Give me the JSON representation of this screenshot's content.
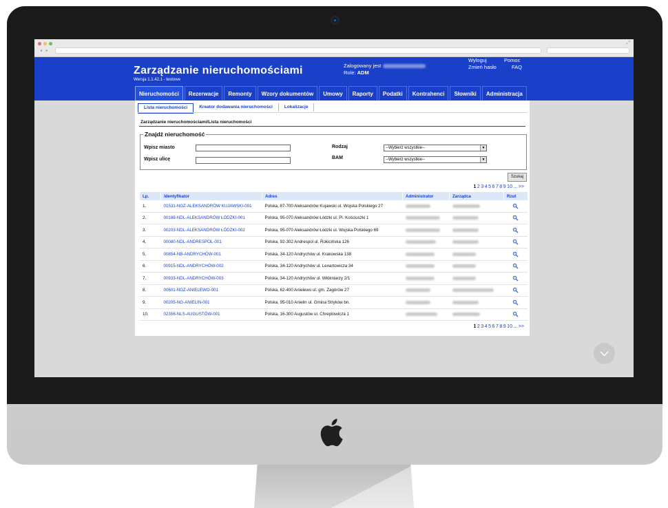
{
  "app": {
    "title": "Zarządzanie nieruchomościami",
    "version": "Wersja 1.1.42.1 - testowe",
    "logged_in_label": "Zalogowany jest",
    "role_label": "Role:",
    "role_value": "ADM",
    "links": {
      "logout": "Wyloguj",
      "change_password": "Zmień hasło",
      "help": "Pomoc",
      "faq": "FAQ"
    }
  },
  "menu": [
    {
      "label": "Nieruchomości",
      "active": true
    },
    {
      "label": "Rezerwacje"
    },
    {
      "label": "Remonty"
    },
    {
      "label": "Wzory dokumentów"
    },
    {
      "label": "Umowy"
    },
    {
      "label": "Raporty"
    },
    {
      "label": "Podatki"
    },
    {
      "label": "Kontrahenci"
    },
    {
      "label": "Słowniki"
    },
    {
      "label": "Administracja"
    }
  ],
  "subtabs": [
    {
      "label": "Lista nieruchomości",
      "active": true
    },
    {
      "label": "Kreator dodawania nieruchomości"
    },
    {
      "label": "Lokalizacje"
    }
  ],
  "breadcrumb": "Zarządzanie nieruchomościami/Lista nieruchomości",
  "search": {
    "legend": "Znajdź nieruchomość",
    "city_label": "Wpisz miasto",
    "street_label": "Wpisz ulicę",
    "type_label": "Rodzaj",
    "type_value": "--Wybierz wszystkie--",
    "bam_label": "BAM",
    "bam_value": "--Wybierz wszystkie--",
    "button": "Szukaj"
  },
  "pager": {
    "pages": [
      "1",
      "2",
      "3",
      "4",
      "5",
      "6",
      "7",
      "8",
      "9",
      "10"
    ],
    "more": "...",
    "next": ">>",
    "current": "1"
  },
  "table": {
    "headers": [
      "Lp.",
      "Identyfikator",
      "Adres",
      "Administrator",
      "Zarządca",
      "Rzut"
    ],
    "rows": [
      {
        "lp": "1.",
        "id": "01531-NGZ-ALEKSANDRÓW KUJAWSKI-001",
        "address": "Polska, 87-700 Aleksandrów Kujawski ul. Wojska Polskiego 27"
      },
      {
        "lp": "2.",
        "id": "00188-NDL-ALEKSANDRÓW ŁÓDZKI-001",
        "address": "Polska, 95-070 Aleksandrów Łódzki ul. Pl. Kościuszki 1"
      },
      {
        "lp": "3.",
        "id": "00203-NDL-ALEKSANDRÓW ŁÓDZKI-002",
        "address": "Polska, 95-070 Aleksandrów Łódzki ul. Wojska Polskiego 69"
      },
      {
        "lp": "4.",
        "id": "00080-NDL-ANDRESPOL-001",
        "address": "Polska, 92-302 Andrespol ul. Rokicińska 126"
      },
      {
        "lp": "5.",
        "id": "00854-NB-ANDRYCHÓW-001",
        "address": "Polska, 34-120 Andrychów ul. Krakowska 138"
      },
      {
        "lp": "6.",
        "id": "00915-NDL-ANDRYCHÓW-002",
        "address": "Polska, 34-120 Andrychów ul. Lenartowicza 34"
      },
      {
        "lp": "7.",
        "id": "00933-NDL-ANDRYCHÓW-003",
        "address": "Polska, 34-120 Andrychów ul. Włókniarzy 2/1"
      },
      {
        "lp": "8.",
        "id": "00601-NGZ-ANIELEWO-001",
        "address": "Polska, 62-400 Anielewo ul. gm. Zagórów 27"
      },
      {
        "lp": "9.",
        "id": "00205-NG-ANIELIN-001",
        "address": "Polska, 95-010 Anielin ul. Gmina Stryków bn."
      },
      {
        "lp": "10.",
        "id": "02356-NLS-AUGUSTÓW-001",
        "address": "Polska, 16-300 Augustów ul. Chreptowicza 1"
      }
    ]
  }
}
